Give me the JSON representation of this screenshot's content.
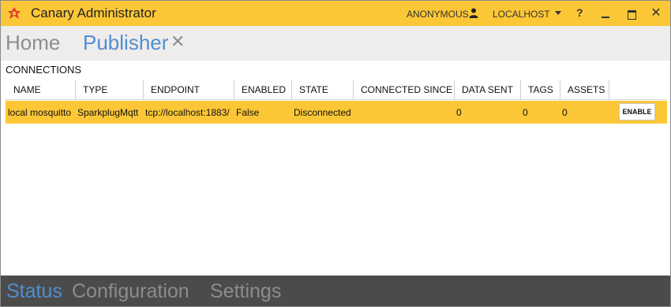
{
  "window": {
    "title": "Canary Administrator"
  },
  "titlebar": {
    "user": "ANONYMOUS",
    "host": "LOCALHOST",
    "help": "?",
    "close_glyph": "✕"
  },
  "tabs": {
    "home": "Home",
    "publisher": "Publisher",
    "close_glyph": "✕"
  },
  "connections": {
    "title": "CONNECTIONS",
    "columns": [
      "NAME",
      "TYPE",
      "ENDPOINT",
      "ENABLED",
      "STATE",
      "CONNECTED SINCE",
      "DATA SENT",
      "TAGS",
      "ASSETS"
    ],
    "rows": [
      {
        "name": "local mosquitto",
        "type": "SparkplugMqtt",
        "endpoint": "tcp://localhost:1883/",
        "enabled": "False",
        "state": "Disconnected",
        "connected_since": "",
        "data_sent": "0",
        "tags": "0",
        "assets": "0",
        "action": "ENABLE"
      }
    ]
  },
  "bottom_nav": {
    "items": [
      "Status",
      "Configuration",
      "Settings"
    ],
    "active": "Status"
  },
  "colors": {
    "accent": "#fcc736",
    "tab_active": "#4f8fd0",
    "bottom_bar": "#4b4b4b"
  },
  "icons": {
    "app": "canary-logo-icon",
    "user": "user-icon",
    "dropdown": "chevron-down-icon"
  }
}
